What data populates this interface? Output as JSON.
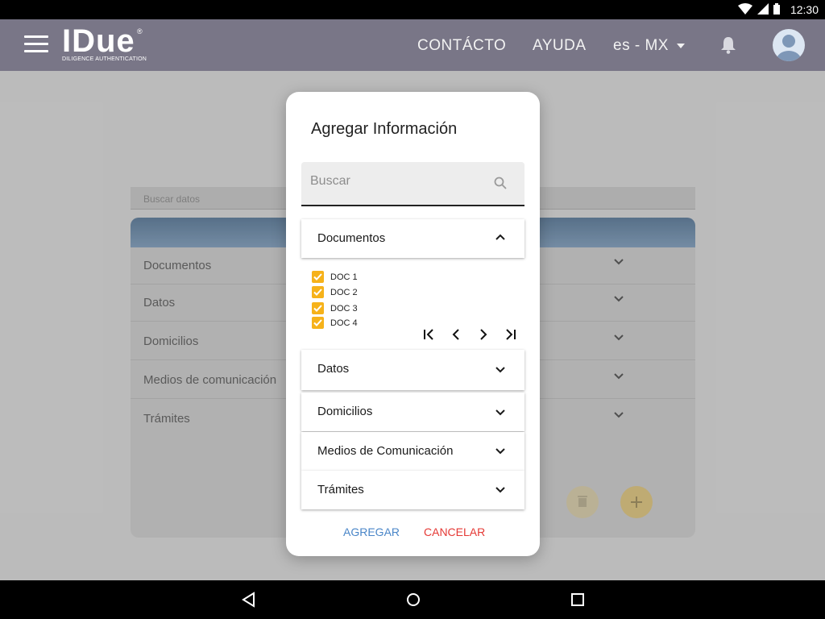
{
  "status_bar": {
    "time": "12:30",
    "icons": [
      "wifi-icon",
      "signal-icon",
      "battery-icon"
    ]
  },
  "app_bar": {
    "logo_text": "IDue",
    "logo_reg": "®",
    "logo_subtitle": "DILIGENCE AUTHENTICATION",
    "nav": [
      "CONTÁCTO",
      "AYUDA"
    ],
    "locale": "es - MX"
  },
  "background": {
    "search_placeholder": "Buscar datos",
    "rows": [
      "Documentos",
      "Datos",
      "Domicilios",
      "Medios de comunicación",
      "Trámites"
    ]
  },
  "dialog": {
    "title": "Agregar Información",
    "search_placeholder": "Buscar",
    "sections": [
      {
        "label": "Documentos",
        "expanded": true
      },
      {
        "label": "Datos",
        "expanded": false
      },
      {
        "label": "Domicilios",
        "expanded": false
      },
      {
        "label": "Medios de Comunicación",
        "expanded": false
      },
      {
        "label": "Trámites",
        "expanded": false
      }
    ],
    "documents": [
      {
        "label": "DOC 1",
        "checked": true
      },
      {
        "label": "DOC 2",
        "checked": true
      },
      {
        "label": "DOC 3",
        "checked": true
      },
      {
        "label": "DOC 4",
        "checked": true
      }
    ],
    "actions": {
      "add": "AGREGAR",
      "cancel": "CANCELAR"
    }
  },
  "colors": {
    "app_bar": "#797687",
    "checkbox": "#f6b21a",
    "add_action": "#4a86c8",
    "cancel_action": "#e53935"
  }
}
